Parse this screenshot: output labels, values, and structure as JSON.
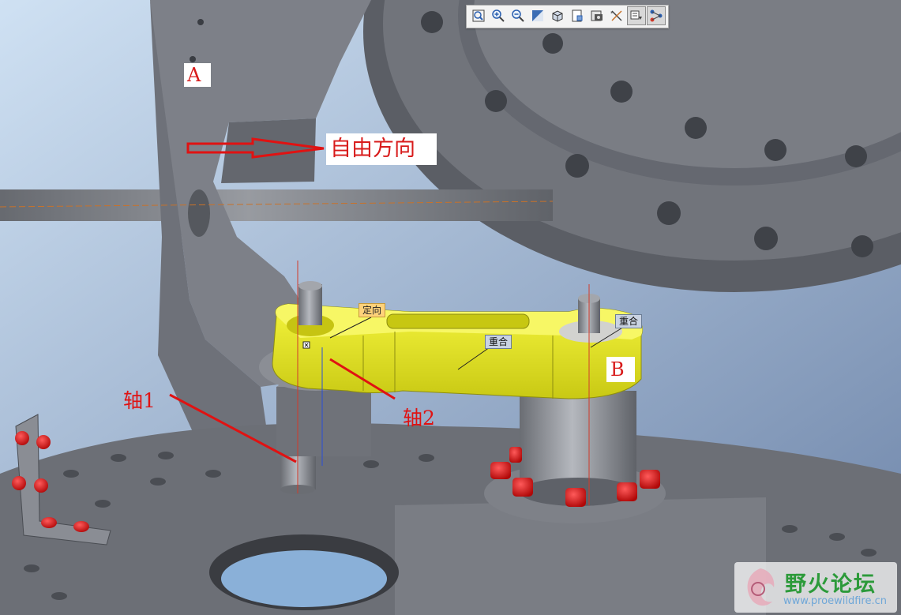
{
  "toolbar": {
    "buttons": [
      {
        "name": "refit-icon",
        "pressed": false
      },
      {
        "name": "zoom-in-icon",
        "pressed": false
      },
      {
        "name": "zoom-out-icon",
        "pressed": false
      },
      {
        "name": "repaint-icon",
        "pressed": false
      },
      {
        "name": "display-style-icon",
        "pressed": false
      },
      {
        "name": "saved-views-icon",
        "pressed": false
      },
      {
        "name": "view-manager-icon",
        "pressed": false
      },
      {
        "name": "datum-display-icon",
        "pressed": false
      },
      {
        "name": "component-display-icon",
        "pressed": true
      },
      {
        "name": "constraint-display-icon",
        "pressed": true
      }
    ]
  },
  "annotations": {
    "label_a": "A",
    "label_free_direction": "自由方向",
    "label_b": "B",
    "label_axis1": "轴1",
    "label_axis2": "轴2"
  },
  "constraints": {
    "orient": "定向",
    "coincident_1": "重合",
    "coincident_2": "重合"
  },
  "watermark": {
    "title": "野火论坛",
    "url": "www.proewildfire.cn"
  },
  "colors": {
    "background_top": "#c8dcf0",
    "background_bottom": "#7f96b8",
    "part_gray": "#7c8088",
    "part_dark": "#5d6068",
    "link_yellow": "#e8e81e",
    "bolt_red": "#e01818",
    "annotation_red": "#e01212"
  }
}
